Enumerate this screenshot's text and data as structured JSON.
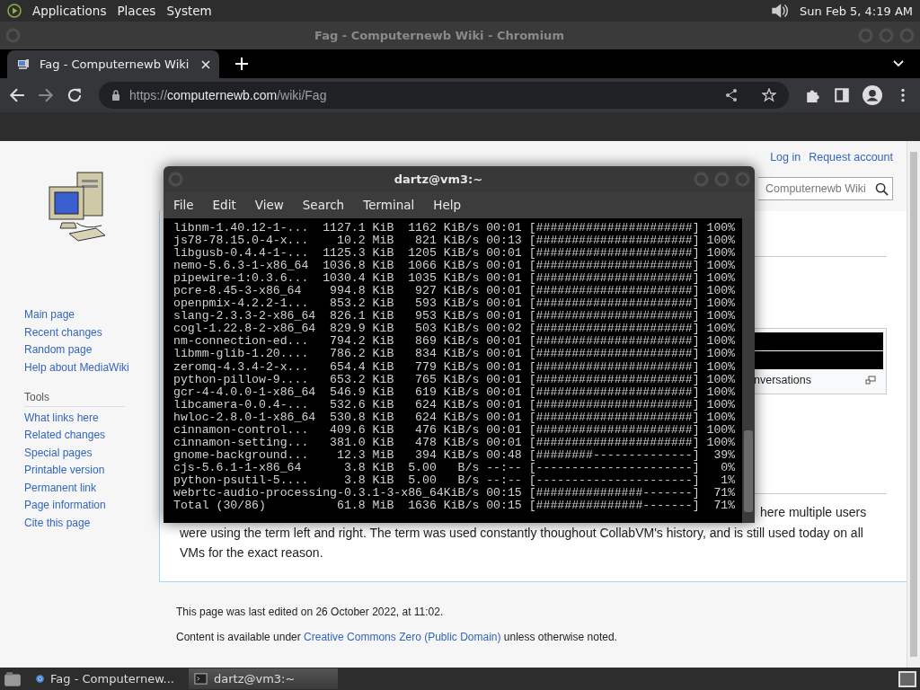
{
  "top_panel": {
    "menus": [
      "Applications",
      "Places",
      "System"
    ],
    "clock": "Sun Feb 5, 4:19 AM"
  },
  "browser": {
    "window_title": "Fag - Computernewb Wiki - Chromium",
    "tabs": [
      {
        "label": "Fag - Computernewb Wiki",
        "selected": true
      }
    ],
    "url": {
      "scheme": "https://",
      "host": "computernewb.com",
      "path": "/wiki/Fag"
    }
  },
  "page": {
    "navigation": [
      "Main page",
      "Recent changes",
      "Random page",
      "Help about MediaWiki"
    ],
    "tools_heading": "Tools",
    "tools": [
      "What links here",
      "Related changes",
      "Special pages",
      "Printable version",
      "Permanent link",
      "Page information",
      "Cite this page"
    ],
    "personal": [
      "Log in",
      "Request account"
    ],
    "search": {
      "placeholder": "Computernewb Wiki"
    },
    "infobox_caption": "nversations",
    "paragraph": [
      "here multiple users",
      "were using the term left and right. The term was used constantly thoughout CollabVM's history, and is still used today on all VMs for the exact reason."
    ],
    "footer": {
      "last_edited": "This page was last edited on 26 October 2022, at 11:02.",
      "license_prefix": "Content is available under ",
      "license_link": "Creative Commons Zero (Public Domain)",
      "license_suffix": " unless otherwise noted."
    }
  },
  "terminal": {
    "title": "dartz@vm3:~",
    "menu": [
      "File",
      "Edit",
      "View",
      "Search",
      "Terminal",
      "Help"
    ],
    "lines": [
      "libnm-1.40.12-1-...  1127.1 KiB  1162 KiB/s 00:01 [######################] 100%",
      "js78-78.15.0-4-x...    10.2 MiB   821 KiB/s 00:13 [######################] 100%",
      "libgusb-0.4.4-1-...  1125.3 KiB  1205 KiB/s 00:01 [######################] 100%",
      "nemo-5.6.3-1-x86_64  1036.8 KiB  1066 KiB/s 00:01 [######################] 100%",
      "pipewire-1:0.3.6...  1030.4 KiB  1035 KiB/s 00:01 [######################] 100%",
      "pcre-8.45-3-x86_64    994.8 KiB   927 KiB/s 00:01 [######################] 100%",
      "openpmix-4.2.2-1...   853.2 KiB   593 KiB/s 00:01 [######################] 100%",
      "slang-2.3.3-2-x86_64  826.1 KiB   953 KiB/s 00:01 [######################] 100%",
      "cogl-1.22.8-2-x86_64  829.9 KiB   503 KiB/s 00:02 [######################] 100%",
      "nm-connection-ed...   794.2 KiB   869 KiB/s 00:01 [######################] 100%",
      "libmm-glib-1.20....   786.2 KiB   834 KiB/s 00:01 [######################] 100%",
      "zeromq-4.3.4-2-x...   654.4 KiB   779 KiB/s 00:01 [######################] 100%",
      "python-pillow-9....   653.2 KiB   765 KiB/s 00:01 [######################] 100%",
      "gcr-4-4.0.0-1-x86_64  546.9 KiB   619 KiB/s 00:01 [######################] 100%",
      "libcamera-0.0.4-...   532.6 KiB   624 KiB/s 00:01 [######################] 100%",
      "hwloc-2.8.0-1-x86_64  530.8 KiB   624 KiB/s 00:01 [######################] 100%",
      "cinnamon-control...   409.6 KiB   476 KiB/s 00:01 [######################] 100%",
      "cinnamon-setting...   381.0 KiB   478 KiB/s 00:01 [######################] 100%",
      "gnome-background...    12.3 MiB   394 KiB/s 00:48 [########--------------]  39%",
      "cjs-5.6.1-1-x86_64      3.8 KiB  5.00   B/s --:-- [----------------------]   0%",
      "python-psutil-5....     3.8 KiB  5.00   B/s --:-- [----------------------]   1%",
      "webrtc-audio-processing-0.3.1-3-x86_64KiB/s 00:15 [###############-------]  71%",
      "Total (30/86)          61.8 MiB  1636 KiB/s 00:15 [###############-------]  71%"
    ]
  },
  "taskbar": {
    "items": [
      {
        "kind": "browser",
        "label": "Fag - Computernew...",
        "selected": false
      },
      {
        "kind": "terminal",
        "label": "dartz@vm3:~",
        "selected": true
      }
    ]
  }
}
